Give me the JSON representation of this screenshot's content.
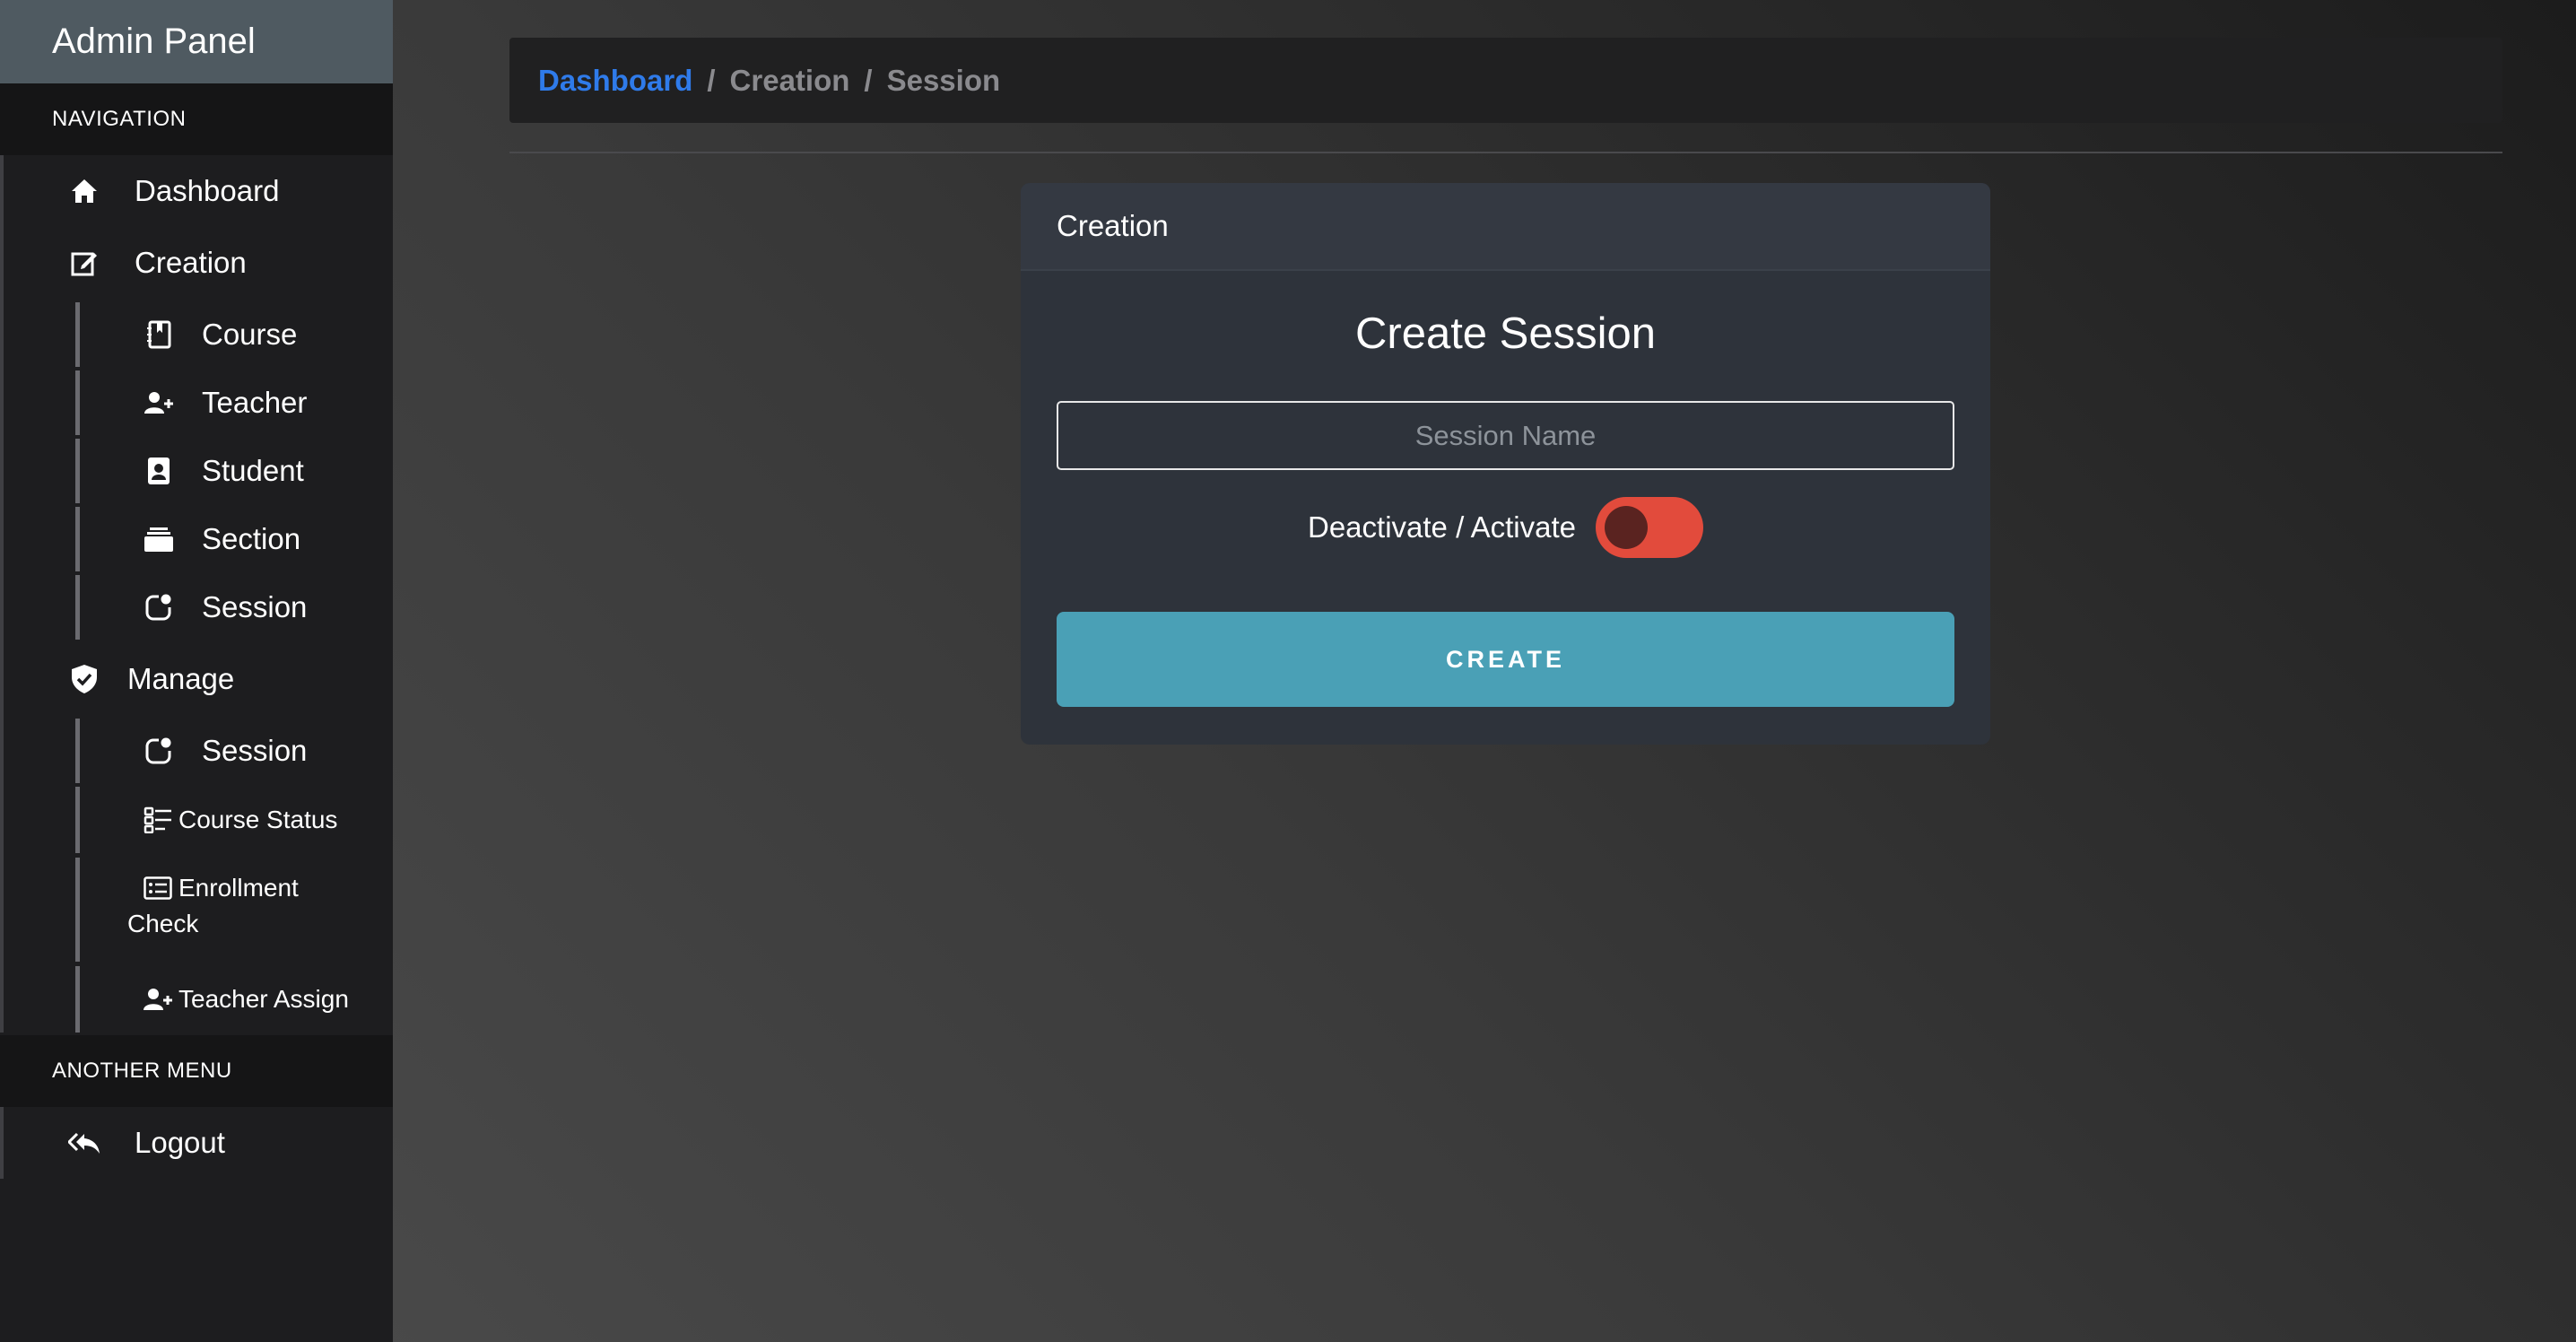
{
  "sidebar": {
    "brand": "Admin Panel",
    "navigation_heading": "NAVIGATION",
    "dashboard": "Dashboard",
    "creation": "Creation",
    "creation_items": {
      "course": "Course",
      "teacher": "Teacher",
      "student": "Student",
      "section": "Section",
      "session": "Session"
    },
    "manage": "Manage",
    "manage_items": {
      "session": "Session",
      "course_status": "Course Status",
      "enrollment_line1": "Enrollment",
      "enrollment_line2": "Check",
      "teacher_assign": "Teacher Assign"
    },
    "another_menu_heading": "ANOTHER MENU",
    "logout": "Logout"
  },
  "breadcrumb": {
    "items": [
      "Dashboard",
      "Creation",
      "Session"
    ],
    "separator": "/"
  },
  "card": {
    "header": "Creation",
    "title": "Create Session",
    "session_name_placeholder": "Session Name",
    "session_name_value": "",
    "toggle_label": "Deactivate / Activate",
    "toggle_state": "off",
    "create_button": "CREATE"
  },
  "colors": {
    "accent_link": "#2f7bea",
    "toggle_off": "#e24b3c",
    "button": "#4aa0b6"
  }
}
